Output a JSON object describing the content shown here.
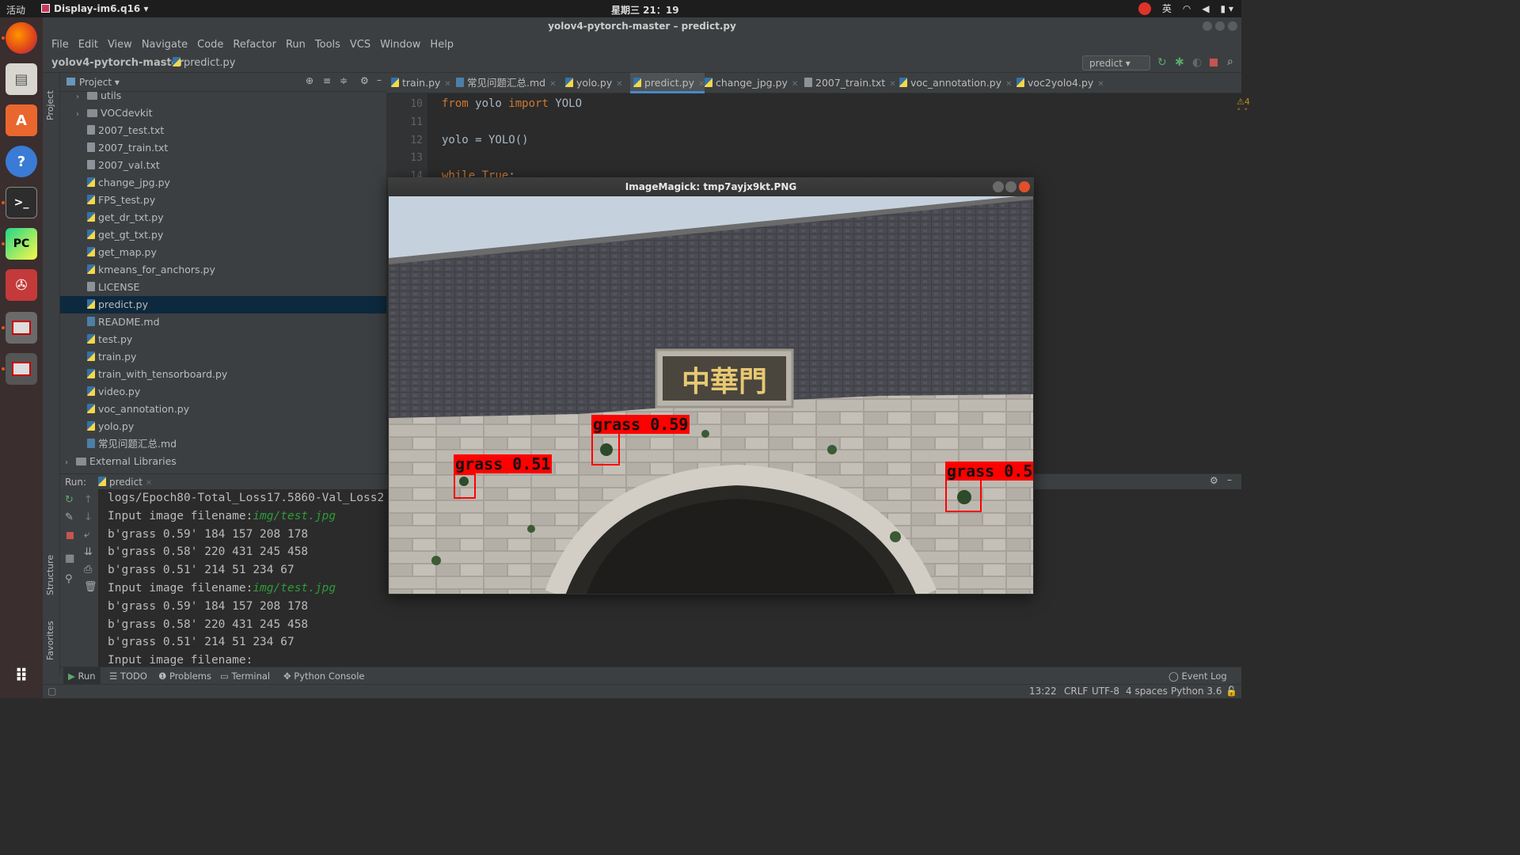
{
  "topbar": {
    "activities": "活动",
    "app_name": "Display-im6.q16",
    "clock": "星期三 21：19",
    "input_method": "英"
  },
  "ide": {
    "window_title": "yolov4-pytorch-master – predict.py",
    "menu": [
      "File",
      "Edit",
      "View",
      "Navigate",
      "Code",
      "Refactor",
      "Run",
      "Tools",
      "VCS",
      "Window",
      "Help"
    ],
    "breadcrumb_project": "yolov4-pytorch-master",
    "breadcrumb_file": "predict.py",
    "run_config": "predict",
    "project_panel_title": "Project",
    "side_labels": {
      "project": "Project",
      "structure": "Structure",
      "favorites": "Favorites"
    }
  },
  "tree": [
    {
      "label": "utils",
      "type": "dir",
      "indent": 1,
      "arrow": "›"
    },
    {
      "label": "VOCdevkit",
      "type": "dir",
      "indent": 1,
      "arrow": "›"
    },
    {
      "label": "2007_test.txt",
      "type": "txt",
      "indent": 2
    },
    {
      "label": "2007_train.txt",
      "type": "txt",
      "indent": 2
    },
    {
      "label": "2007_val.txt",
      "type": "txt",
      "indent": 2
    },
    {
      "label": "change_jpg.py",
      "type": "py",
      "indent": 2
    },
    {
      "label": "FPS_test.py",
      "type": "py",
      "indent": 2
    },
    {
      "label": "get_dr_txt.py",
      "type": "py",
      "indent": 2
    },
    {
      "label": "get_gt_txt.py",
      "type": "py",
      "indent": 2
    },
    {
      "label": "get_map.py",
      "type": "py",
      "indent": 2
    },
    {
      "label": "kmeans_for_anchors.py",
      "type": "py",
      "indent": 2
    },
    {
      "label": "LICENSE",
      "type": "txt",
      "indent": 2
    },
    {
      "label": "predict.py",
      "type": "py",
      "indent": 2,
      "selected": true
    },
    {
      "label": "README.md",
      "type": "md",
      "indent": 2
    },
    {
      "label": "test.py",
      "type": "py",
      "indent": 2
    },
    {
      "label": "train.py",
      "type": "py",
      "indent": 2
    },
    {
      "label": "train_with_tensorboard.py",
      "type": "py",
      "indent": 2
    },
    {
      "label": "video.py",
      "type": "py",
      "indent": 2
    },
    {
      "label": "voc_annotation.py",
      "type": "py",
      "indent": 2
    },
    {
      "label": "yolo.py",
      "type": "py",
      "indent": 2
    },
    {
      "label": "常见问题汇总.md",
      "type": "md",
      "indent": 2
    },
    {
      "label": "External Libraries",
      "type": "lib",
      "indent": 0,
      "arrow": "›"
    }
  ],
  "editor_tabs": [
    {
      "label": "train.py",
      "active": false
    },
    {
      "label": "常见问题汇总.md",
      "active": false
    },
    {
      "label": "yolo.py",
      "active": false
    },
    {
      "label": "predict.py",
      "active": true
    },
    {
      "label": "change_jpg.py",
      "active": false
    },
    {
      "label": "2007_train.txt",
      "active": false
    },
    {
      "label": "voc_annotation.py",
      "active": false
    },
    {
      "label": "voc2yolo4.py",
      "active": false
    }
  ],
  "editor": {
    "warning_count": "4",
    "lines": [
      {
        "num": "10",
        "kw": "from",
        "rest": " yolo ",
        "kw2": "import",
        "rest2": " YOLO"
      },
      {
        "num": "11",
        "kw": "",
        "rest": "",
        "kw2": "",
        "rest2": ""
      },
      {
        "num": "12",
        "kw": "",
        "rest": "yolo = YOLO()",
        "kw2": "",
        "rest2": ""
      },
      {
        "num": "13",
        "kw": "",
        "rest": "",
        "kw2": "",
        "rest2": ""
      },
      {
        "num": "14",
        "kw": "while",
        "rest": " ",
        "kw2": "True",
        "rest2": ":"
      }
    ]
  },
  "run": {
    "label": "Run:",
    "tab": "predict",
    "console": [
      {
        "text": "logs/Epoch80-Total_Loss17.5860-Val_Loss2",
        "link": ""
      },
      {
        "text": "Input image filename:",
        "link": "img/test.jpg"
      },
      {
        "text": "b'grass 0.59' 184 157 208 178",
        "link": ""
      },
      {
        "text": "b'grass 0.58' 220 431 245 458",
        "link": ""
      },
      {
        "text": "b'grass 0.51' 214 51 234 67",
        "link": ""
      },
      {
        "text": "Input image filename:",
        "link": "img/test.jpg"
      },
      {
        "text": "b'grass 0.59' 184 157 208 178",
        "link": ""
      },
      {
        "text": "b'grass 0.58' 220 431 245 458",
        "link": ""
      },
      {
        "text": "b'grass 0.51' 214 51 234 67",
        "link": ""
      },
      {
        "text": "Input image filename:",
        "link": ""
      }
    ]
  },
  "tool_tabs": [
    "Run",
    "TODO",
    "Problems",
    "Terminal",
    "Python Console"
  ],
  "event_log": "Event Log",
  "status": {
    "position": "13:22",
    "line_sep": "CRLF",
    "encoding": "UTF-8",
    "indent": "4 spaces",
    "interpreter": "Python 3.6"
  },
  "imagemagick": {
    "title": "ImageMagick: tmp7ayjx9kt.PNG",
    "plaque_text": "中華門",
    "detections": [
      {
        "label": "grass 0.59"
      },
      {
        "label": "grass 0.51"
      },
      {
        "label": "grass 0.5"
      }
    ]
  },
  "colors": {
    "accent": "#4a88c7",
    "selection": "#0d293e",
    "keyword": "#cc7832",
    "link_green": "#2e9b3a",
    "detection_red": "#ff0000"
  }
}
